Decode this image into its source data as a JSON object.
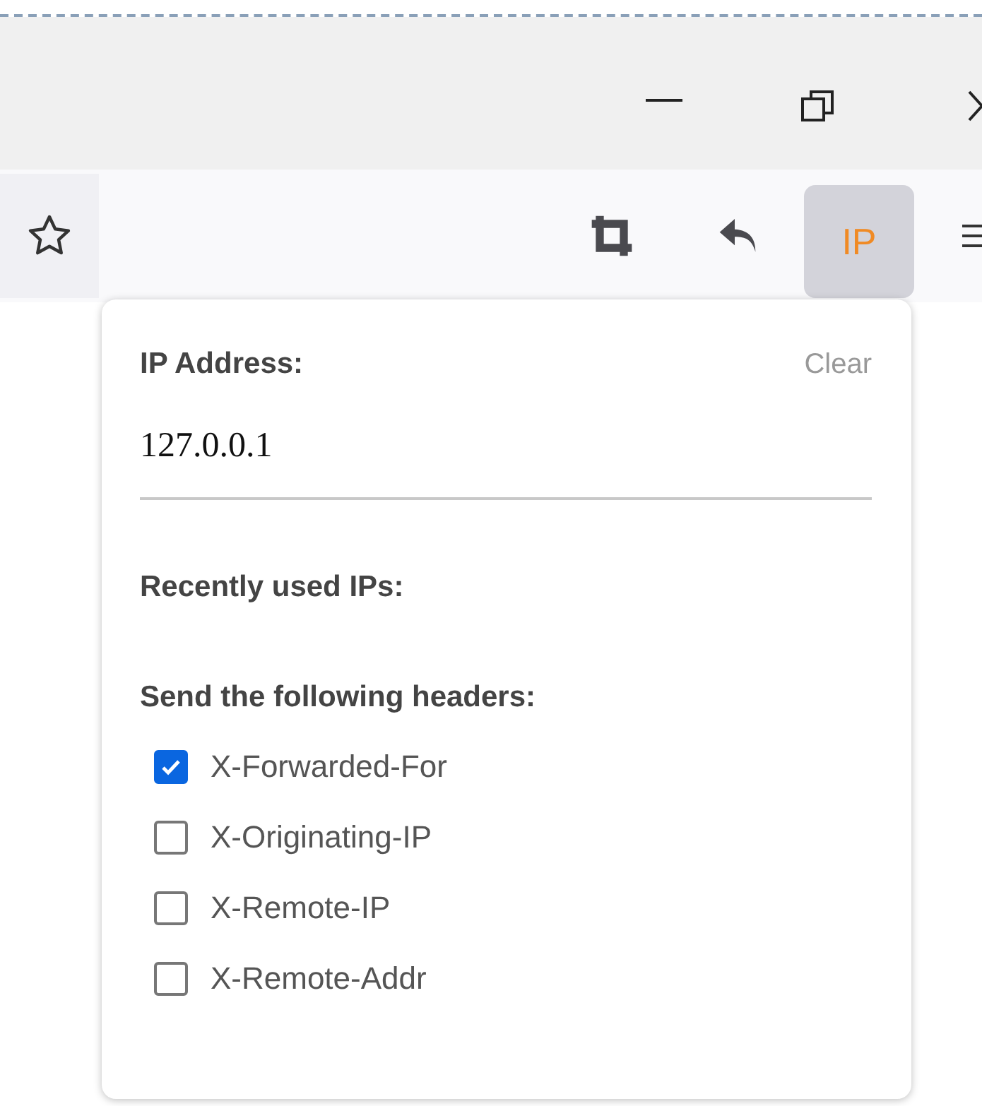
{
  "toolbar": {
    "extension_button": {
      "label": "IP",
      "selected": true
    }
  },
  "popup": {
    "title": "IP Address:",
    "clear_link": "Clear",
    "ip_field": {
      "value": "127.0.0.1"
    },
    "recent_heading": "Recently used IPs:",
    "headers_heading": "Send the following headers:",
    "headers": [
      {
        "label": "X-Forwarded-For",
        "checked": true
      },
      {
        "label": "X-Originating-IP",
        "checked": false
      },
      {
        "label": "X-Remote-IP",
        "checked": false
      },
      {
        "label": "X-Remote-Addr",
        "checked": false
      }
    ]
  }
}
